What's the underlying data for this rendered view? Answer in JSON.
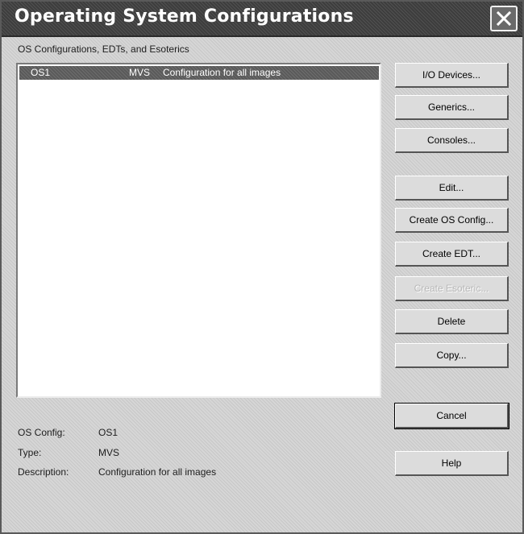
{
  "window": {
    "title": "Operating System Configurations"
  },
  "group_label": "OS Configurations, EDTs, and Esoterics",
  "list": {
    "rows": [
      {
        "name": "OS1",
        "type": "MVS",
        "description": "Configuration for all images"
      }
    ]
  },
  "buttons": {
    "io_devices": "I/O Devices...",
    "generics": "Generics...",
    "consoles": "Consoles...",
    "edit": "Edit...",
    "create_os_config": "Create OS Config...",
    "create_edt": "Create EDT...",
    "create_esoteric": "Create Esoteric...",
    "delete": "Delete",
    "copy": "Copy...",
    "cancel": "Cancel",
    "help": "Help"
  },
  "details": {
    "os_config_label": "OS Config:",
    "os_config_value": "OS1",
    "type_label": "Type:",
    "type_value": "MVS",
    "description_label": "Description:",
    "description_value": "Configuration for all images"
  }
}
